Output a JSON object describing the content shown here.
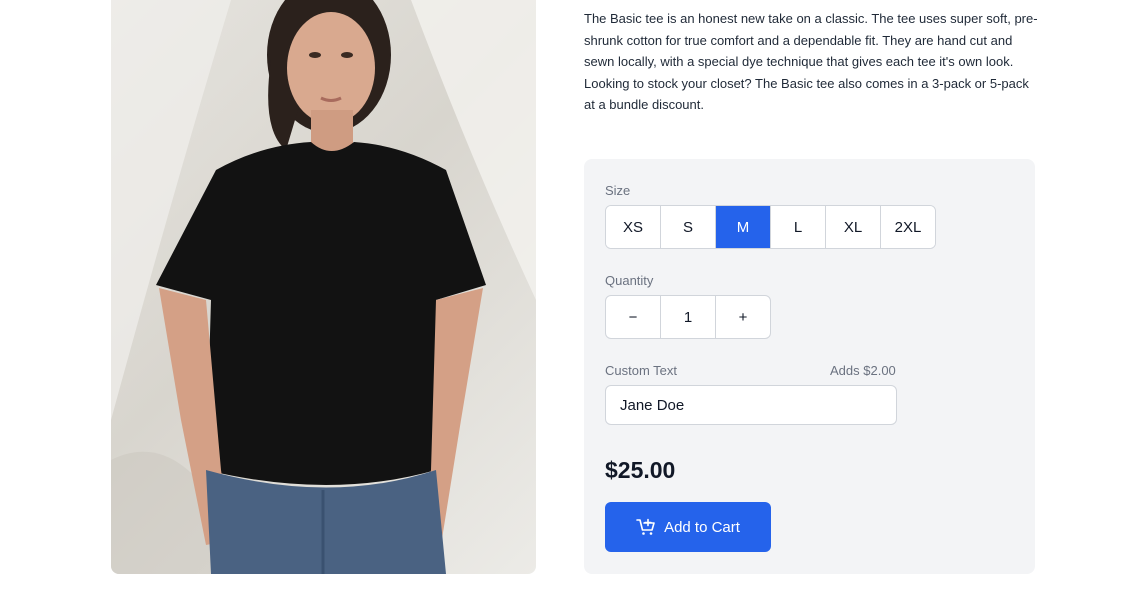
{
  "product": {
    "image_alt": "Woman wearing black basic tee and jeans",
    "description": "The Basic tee is an honest new take on a classic. The tee uses super soft, pre-shrunk cotton for true comfort and a dependable fit. They are hand cut and sewn locally, with a special dye technique that gives each tee it's own look. Looking to stock your closet? The Basic tee also comes in a 3-pack or 5-pack at a bundle discount."
  },
  "options": {
    "size_label": "Size",
    "sizes": [
      "XS",
      "S",
      "M",
      "L",
      "XL",
      "2XL"
    ],
    "selected_size": "M",
    "quantity_label": "Quantity",
    "quantity_decrement": "−",
    "quantity_value": "1",
    "quantity_increment": "+",
    "custom_text_label": "Custom Text",
    "custom_text_note": "Adds $2.00",
    "custom_text_value": "Jane Doe",
    "price": "$25.00",
    "add_to_cart_label": "Add to Cart",
    "add_to_cart_icon": "cart-plus-icon"
  },
  "colors": {
    "accent": "#2563eb",
    "panel_bg": "#f3f4f6",
    "border": "#d1d5db"
  }
}
